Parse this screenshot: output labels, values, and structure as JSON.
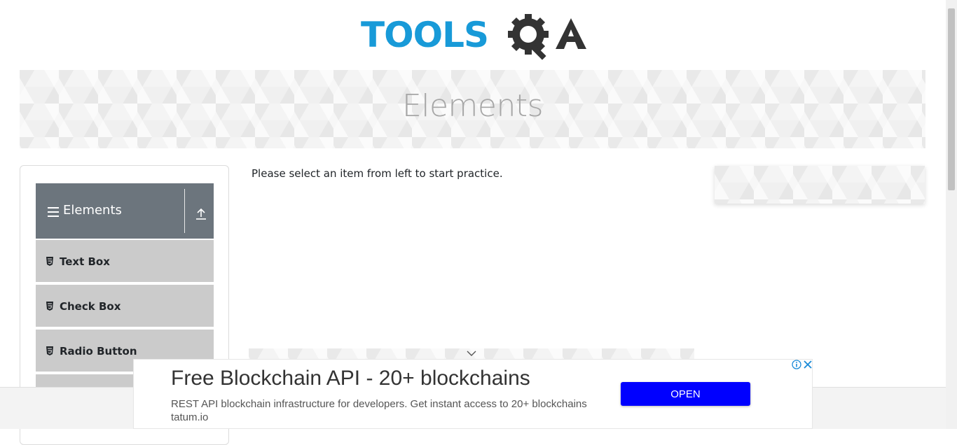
{
  "logo": {
    "text_tools": "TOOLS",
    "text_qa": "QA"
  },
  "banner": {
    "title": "Elements"
  },
  "sidebar": {
    "group_title": "Elements",
    "items": [
      {
        "label": "Text Box"
      },
      {
        "label": "Check Box"
      },
      {
        "label": "Radio Button"
      },
      {
        "label": ""
      }
    ]
  },
  "main": {
    "message": "Please select an item from left to start practice."
  },
  "ad": {
    "title": "Free Blockchain API - 20+ blockchains",
    "description": "REST API blockchain infrastructure for developers. Get instant access to 20+ blockchains tatum.io",
    "button_label": "OPEN"
  },
  "colors": {
    "brand_blue": "#189ad8",
    "header_grey": "#6c757d",
    "menu_item": "#cbcbcb",
    "ad_button": "#0000ff"
  }
}
